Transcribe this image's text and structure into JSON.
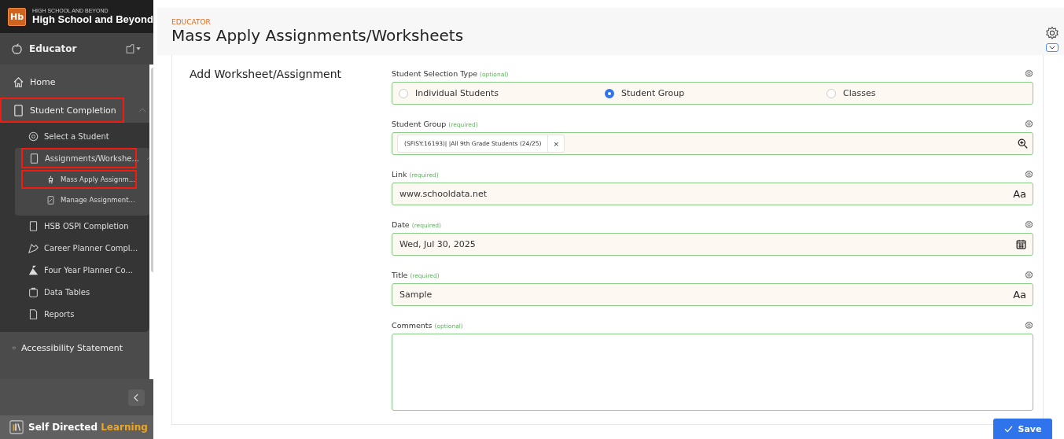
{
  "sidebar": {
    "brand_small": "HIGH SCHOOL AND BEYOND",
    "brand": "High School and Beyond",
    "logo": "Hb",
    "role": "Educator",
    "items": [
      {
        "label": "Home",
        "highlighted": false
      },
      {
        "label": "Student Completion",
        "expanded": true,
        "highlighted": true,
        "children": [
          {
            "label": "Select a Student",
            "highlighted": false
          },
          {
            "label": "Assignments/Workshe...",
            "expanded": true,
            "highlighted": true,
            "children": [
              {
                "label": "Mass Apply Assignm...",
                "highlighted": true
              },
              {
                "label": "Manage Assignment...",
                "highlighted": false
              }
            ]
          },
          {
            "label": "HSB OSPI Completion",
            "highlighted": false
          },
          {
            "label": "Career Planner Compl...",
            "highlighted": false
          },
          {
            "label": "Four Year Planner Co...",
            "highlighted": false
          },
          {
            "label": "Data Tables",
            "highlighted": false
          },
          {
            "label": "Reports",
            "highlighted": false
          }
        ]
      },
      {
        "label": "Accessibility Statement",
        "highlighted": false
      }
    ],
    "footer_name": "Self Directed",
    "footer_accent": "Learning"
  },
  "header": {
    "eyebrow": "EDUCATOR",
    "title": "Mass Apply Assignments/Worksheets"
  },
  "form": {
    "section_title": "Add Worksheet/Assignment",
    "fields": [
      {
        "kind": "radio",
        "label": "Student Selection Type",
        "note": "(optional)",
        "options": [
          {
            "label": "Individual Students",
            "selected": false
          },
          {
            "label": "Student Group",
            "selected": true
          },
          {
            "label": "Classes",
            "selected": false
          }
        ]
      },
      {
        "kind": "tags",
        "label": "Student Group",
        "note": "(required)",
        "tags": [
          "(SFISY:16193)| |All 9th Grade Students (24/25)"
        ],
        "remove": "×"
      },
      {
        "kind": "text",
        "label": "Link",
        "note": "(required)",
        "value": "www.schooldata.net",
        "adornment": "Aa"
      },
      {
        "kind": "date",
        "label": "Date",
        "note": "(required)",
        "value": "Wed, Jul 30, 2025"
      },
      {
        "kind": "text",
        "label": "Title",
        "note": "(required)",
        "value": "Sample",
        "adornment": "Aa"
      },
      {
        "kind": "textarea",
        "label": "Comments",
        "note": "(optional)"
      }
    ]
  },
  "save_button": "Save"
}
